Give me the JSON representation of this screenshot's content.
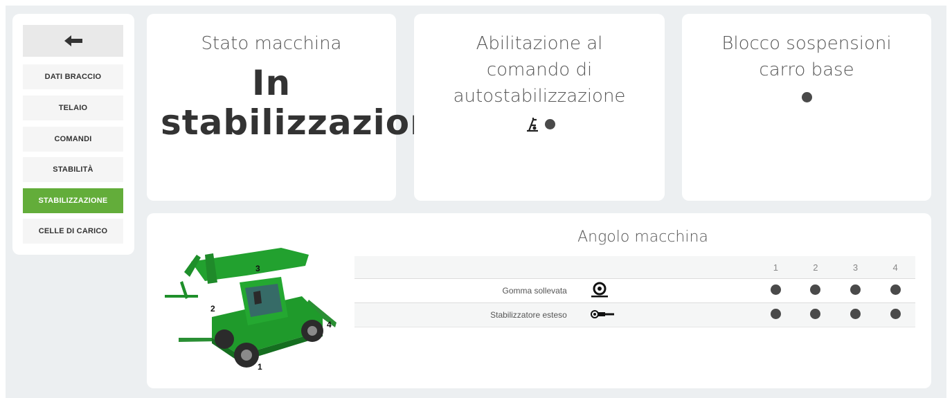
{
  "sidebar": {
    "back_icon": "arrow-left-icon",
    "items": [
      {
        "label": "DATI BRACCIO",
        "active": false
      },
      {
        "label": "TELAIO",
        "active": false
      },
      {
        "label": "COMANDI",
        "active": false
      },
      {
        "label": "STABILITÀ",
        "active": false
      },
      {
        "label": "STABILIZZAZIONE",
        "active": true
      },
      {
        "label": "CELLE DI CARICO",
        "active": false
      }
    ]
  },
  "cards": {
    "machine_state": {
      "title": "Stato macchina",
      "value": "In stabilizzazione"
    },
    "auto_stabilization": {
      "title": "Abilitazione al comando di autostabilizzazione",
      "icon": "auto-stabilization-icon",
      "indicator": "off"
    },
    "suspension_lock": {
      "title": "Blocco sospensioni carro base",
      "indicator": "off"
    }
  },
  "machine_angle": {
    "title": "Angolo macchina",
    "diagram_labels": [
      "1",
      "2",
      "3",
      "4"
    ],
    "columns": [
      "1",
      "2",
      "3",
      "4"
    ],
    "rows": [
      {
        "label": "Gomma sollevata",
        "icon": "tire-icon",
        "states": [
          "off",
          "off",
          "off",
          "off"
        ]
      },
      {
        "label": "Stabilizzatore esteso",
        "icon": "stabilizer-icon",
        "states": [
          "off",
          "off",
          "off",
          "off"
        ]
      }
    ]
  },
  "colors": {
    "accent": "#63ad3a",
    "indicator": "#4a4a4a",
    "machine_green": "#1e9a2a",
    "background": "#eceff1"
  }
}
